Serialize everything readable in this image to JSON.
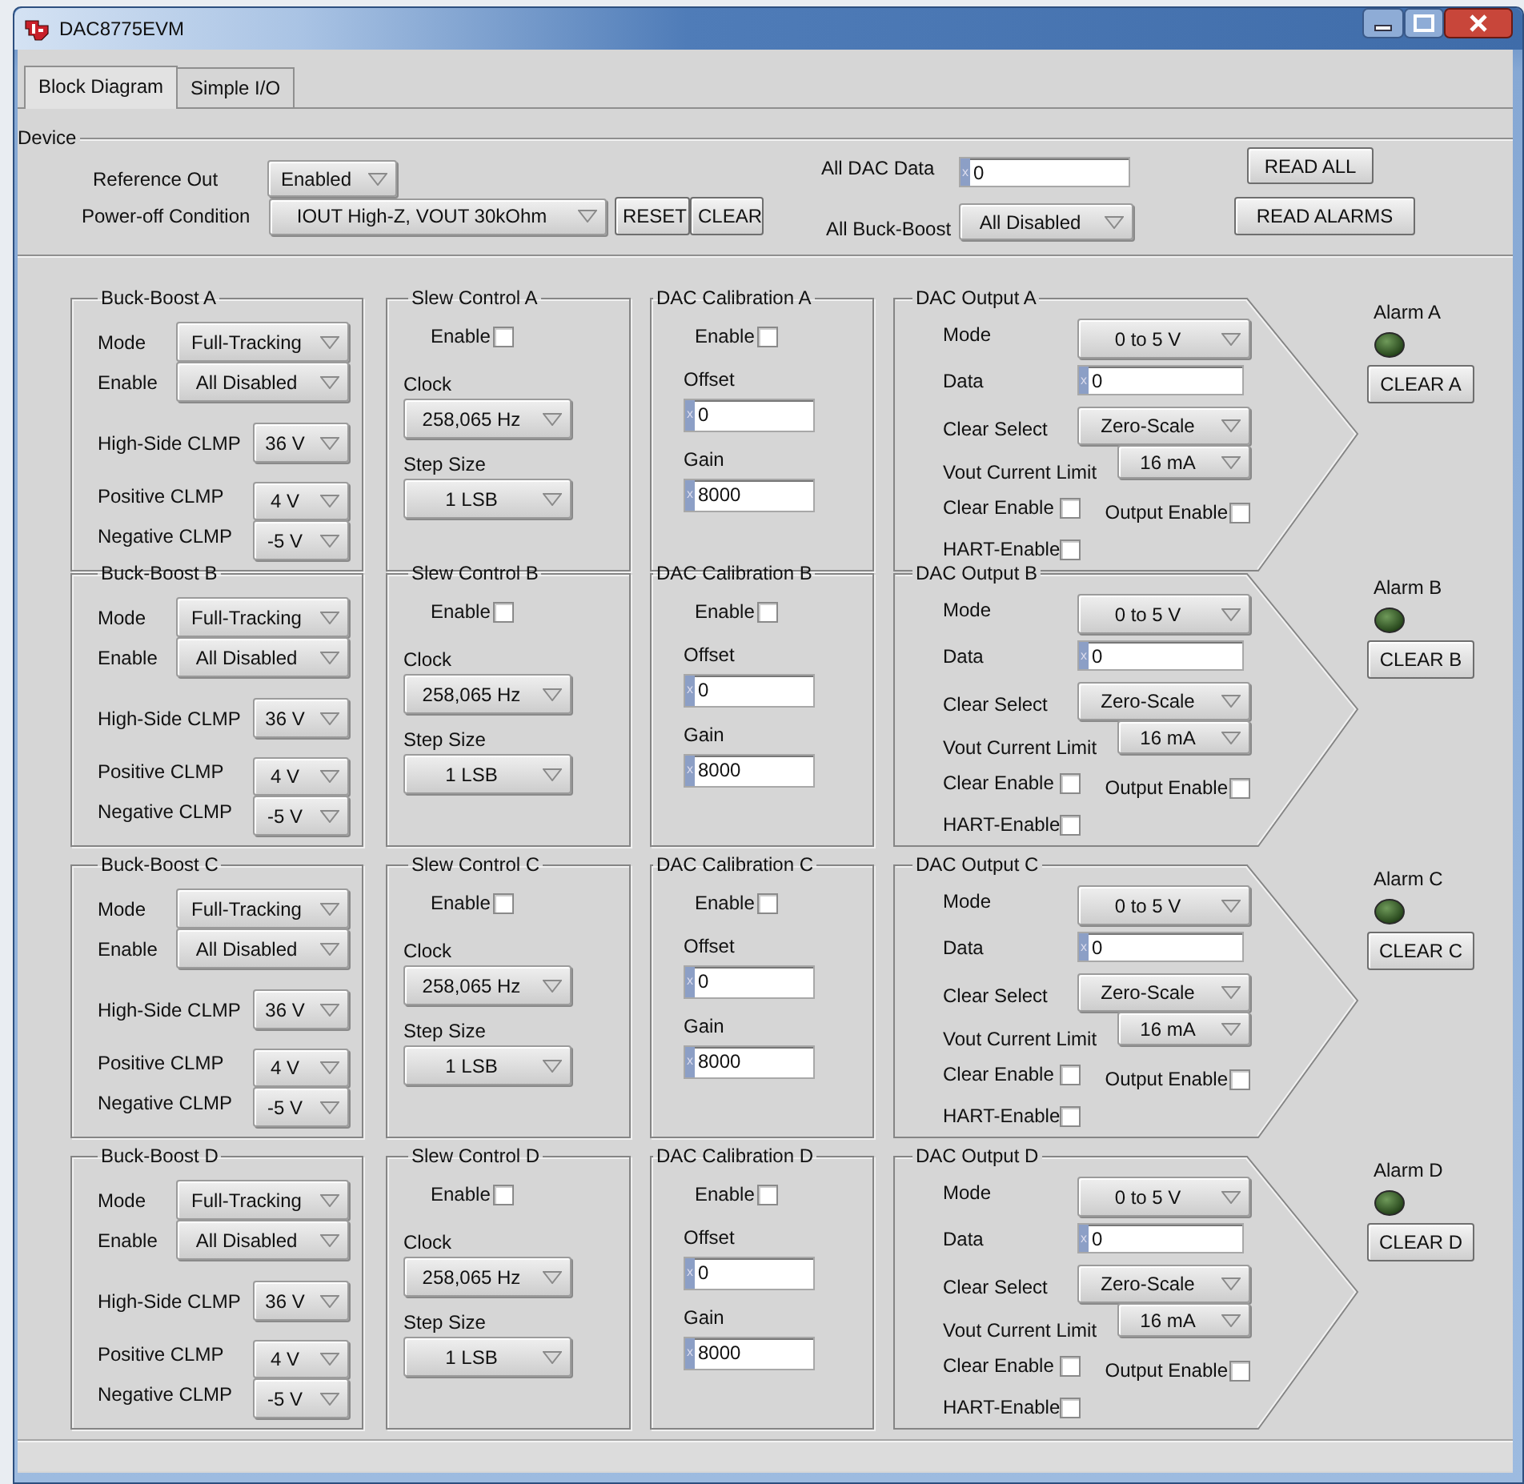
{
  "window": {
    "title": "DAC8775EVM"
  },
  "tabs": [
    {
      "label": "Block Diagram",
      "selected": true
    },
    {
      "label": "Simple I/O",
      "selected": false
    }
  ],
  "device": {
    "title": "Device",
    "reference_out": {
      "label": "Reference Out",
      "value": "Enabled"
    },
    "power_off_condition": {
      "label": "Power-off Condition",
      "value": "IOUT High-Z, VOUT 30kOhm"
    },
    "reset_button": "RESET",
    "clear_button": "CLEAR",
    "all_dac_data": {
      "label": "All DAC Data",
      "radix": "x",
      "value": "0"
    },
    "all_buck_boost": {
      "label": "All Buck-Boost",
      "value": "All Disabled"
    },
    "read_all_button": "READ ALL",
    "read_alarms_button": "READ ALARMS"
  },
  "channels": [
    {
      "buck_boost": {
        "title": "Buck-Boost A",
        "mode": {
          "label": "Mode",
          "value": "Full-Tracking"
        },
        "enable": {
          "label": "Enable",
          "value": "All Disabled"
        },
        "high_side_clamp": {
          "label": "High-Side CLMP",
          "value": "36 V"
        },
        "positive_clamp": {
          "label": "Positive CLMP",
          "value": "4 V"
        },
        "negative_clamp": {
          "label": "Negative CLMP",
          "value": "-5 V"
        }
      },
      "slew_control": {
        "title": "Slew Control A",
        "enable": {
          "label": "Enable",
          "checked": false
        },
        "clock": {
          "label": "Clock",
          "value": "258,065 Hz"
        },
        "step_size": {
          "label": "Step Size",
          "value": "1 LSB"
        }
      },
      "calibration": {
        "title": "DAC Calibration A",
        "enable": {
          "label": "Enable",
          "checked": false
        },
        "offset": {
          "label": "Offset",
          "radix": "x",
          "value": "0"
        },
        "gain": {
          "label": "Gain",
          "radix": "x",
          "value": "8000"
        }
      },
      "output": {
        "title": "DAC Output A",
        "mode": {
          "label": "Mode",
          "value": "0 to 5 V"
        },
        "data": {
          "label": "Data",
          "radix": "x",
          "value": "0"
        },
        "clear_select": {
          "label": "Clear Select",
          "value": "Zero-Scale"
        },
        "current_limit": {
          "label": "Vout Current Limit",
          "value": "16 mA"
        },
        "clear_enable": {
          "label": "Clear Enable",
          "checked": false
        },
        "output_enable": {
          "label": "Output Enable",
          "checked": false
        },
        "hart_enable": {
          "label": "HART-Enable",
          "checked": false
        }
      },
      "alarm": {
        "label": "Alarm A",
        "on": false
      },
      "clear_button": "CLEAR A"
    },
    {
      "buck_boost": {
        "title": "Buck-Boost B",
        "mode": {
          "label": "Mode",
          "value": "Full-Tracking"
        },
        "enable": {
          "label": "Enable",
          "value": "All Disabled"
        },
        "high_side_clamp": {
          "label": "High-Side CLMP",
          "value": "36 V"
        },
        "positive_clamp": {
          "label": "Positive CLMP",
          "value": "4 V"
        },
        "negative_clamp": {
          "label": "Negative CLMP",
          "value": "-5 V"
        }
      },
      "slew_control": {
        "title": "Slew Control B",
        "enable": {
          "label": "Enable",
          "checked": false
        },
        "clock": {
          "label": "Clock",
          "value": "258,065 Hz"
        },
        "step_size": {
          "label": "Step Size",
          "value": "1 LSB"
        }
      },
      "calibration": {
        "title": "DAC Calibration B",
        "enable": {
          "label": "Enable",
          "checked": false
        },
        "offset": {
          "label": "Offset",
          "radix": "x",
          "value": "0"
        },
        "gain": {
          "label": "Gain",
          "radix": "x",
          "value": "8000"
        }
      },
      "output": {
        "title": "DAC Output B",
        "mode": {
          "label": "Mode",
          "value": "0 to 5 V"
        },
        "data": {
          "label": "Data",
          "radix": "x",
          "value": "0"
        },
        "clear_select": {
          "label": "Clear Select",
          "value": "Zero-Scale"
        },
        "current_limit": {
          "label": "Vout Current Limit",
          "value": "16 mA"
        },
        "clear_enable": {
          "label": "Clear Enable",
          "checked": false
        },
        "output_enable": {
          "label": "Output Enable",
          "checked": false
        },
        "hart_enable": {
          "label": "HART-Enable",
          "checked": false
        }
      },
      "alarm": {
        "label": "Alarm B",
        "on": false
      },
      "clear_button": "CLEAR B"
    },
    {
      "buck_boost": {
        "title": "Buck-Boost C",
        "mode": {
          "label": "Mode",
          "value": "Full-Tracking"
        },
        "enable": {
          "label": "Enable",
          "value": "All Disabled"
        },
        "high_side_clamp": {
          "label": "High-Side CLMP",
          "value": "36 V"
        },
        "positive_clamp": {
          "label": "Positive CLMP",
          "value": "4 V"
        },
        "negative_clamp": {
          "label": "Negative CLMP",
          "value": "-5 V"
        }
      },
      "slew_control": {
        "title": "Slew Control C",
        "enable": {
          "label": "Enable",
          "checked": false
        },
        "clock": {
          "label": "Clock",
          "value": "258,065 Hz"
        },
        "step_size": {
          "label": "Step Size",
          "value": "1 LSB"
        }
      },
      "calibration": {
        "title": "DAC Calibration C",
        "enable": {
          "label": "Enable",
          "checked": false
        },
        "offset": {
          "label": "Offset",
          "radix": "x",
          "value": "0"
        },
        "gain": {
          "label": "Gain",
          "radix": "x",
          "value": "8000"
        }
      },
      "output": {
        "title": "DAC Output C",
        "mode": {
          "label": "Mode",
          "value": "0 to 5 V"
        },
        "data": {
          "label": "Data",
          "radix": "x",
          "value": "0"
        },
        "clear_select": {
          "label": "Clear Select",
          "value": "Zero-Scale"
        },
        "current_limit": {
          "label": "Vout Current Limit",
          "value": "16 mA"
        },
        "clear_enable": {
          "label": "Clear Enable",
          "checked": false
        },
        "output_enable": {
          "label": "Output Enable",
          "checked": false
        },
        "hart_enable": {
          "label": "HART-Enable",
          "checked": false
        }
      },
      "alarm": {
        "label": "Alarm C",
        "on": false
      },
      "clear_button": "CLEAR C"
    },
    {
      "buck_boost": {
        "title": "Buck-Boost D",
        "mode": {
          "label": "Mode",
          "value": "Full-Tracking"
        },
        "enable": {
          "label": "Enable",
          "value": "All Disabled"
        },
        "high_side_clamp": {
          "label": "High-Side CLMP",
          "value": "36 V"
        },
        "positive_clamp": {
          "label": "Positive CLMP",
          "value": "4 V"
        },
        "negative_clamp": {
          "label": "Negative CLMP",
          "value": "-5 V"
        }
      },
      "slew_control": {
        "title": "Slew Control D",
        "enable": {
          "label": "Enable",
          "checked": false
        },
        "clock": {
          "label": "Clock",
          "value": "258,065 Hz"
        },
        "step_size": {
          "label": "Step Size",
          "value": "1 LSB"
        }
      },
      "calibration": {
        "title": "DAC Calibration D",
        "enable": {
          "label": "Enable",
          "checked": false
        },
        "offset": {
          "label": "Offset",
          "radix": "x",
          "value": "0"
        },
        "gain": {
          "label": "Gain",
          "radix": "x",
          "value": "8000"
        }
      },
      "output": {
        "title": "DAC Output D",
        "mode": {
          "label": "Mode",
          "value": "0 to 5 V"
        },
        "data": {
          "label": "Data",
          "radix": "x",
          "value": "0"
        },
        "clear_select": {
          "label": "Clear Select",
          "value": "Zero-Scale"
        },
        "current_limit": {
          "label": "Vout Current Limit",
          "value": "16 mA"
        },
        "clear_enable": {
          "label": "Clear Enable",
          "checked": false
        },
        "output_enable": {
          "label": "Output Enable",
          "checked": false
        },
        "hart_enable": {
          "label": "HART-Enable",
          "checked": false
        }
      },
      "alarm": {
        "label": "Alarm D",
        "on": false
      },
      "clear_button": "CLEAR D"
    }
  ]
}
